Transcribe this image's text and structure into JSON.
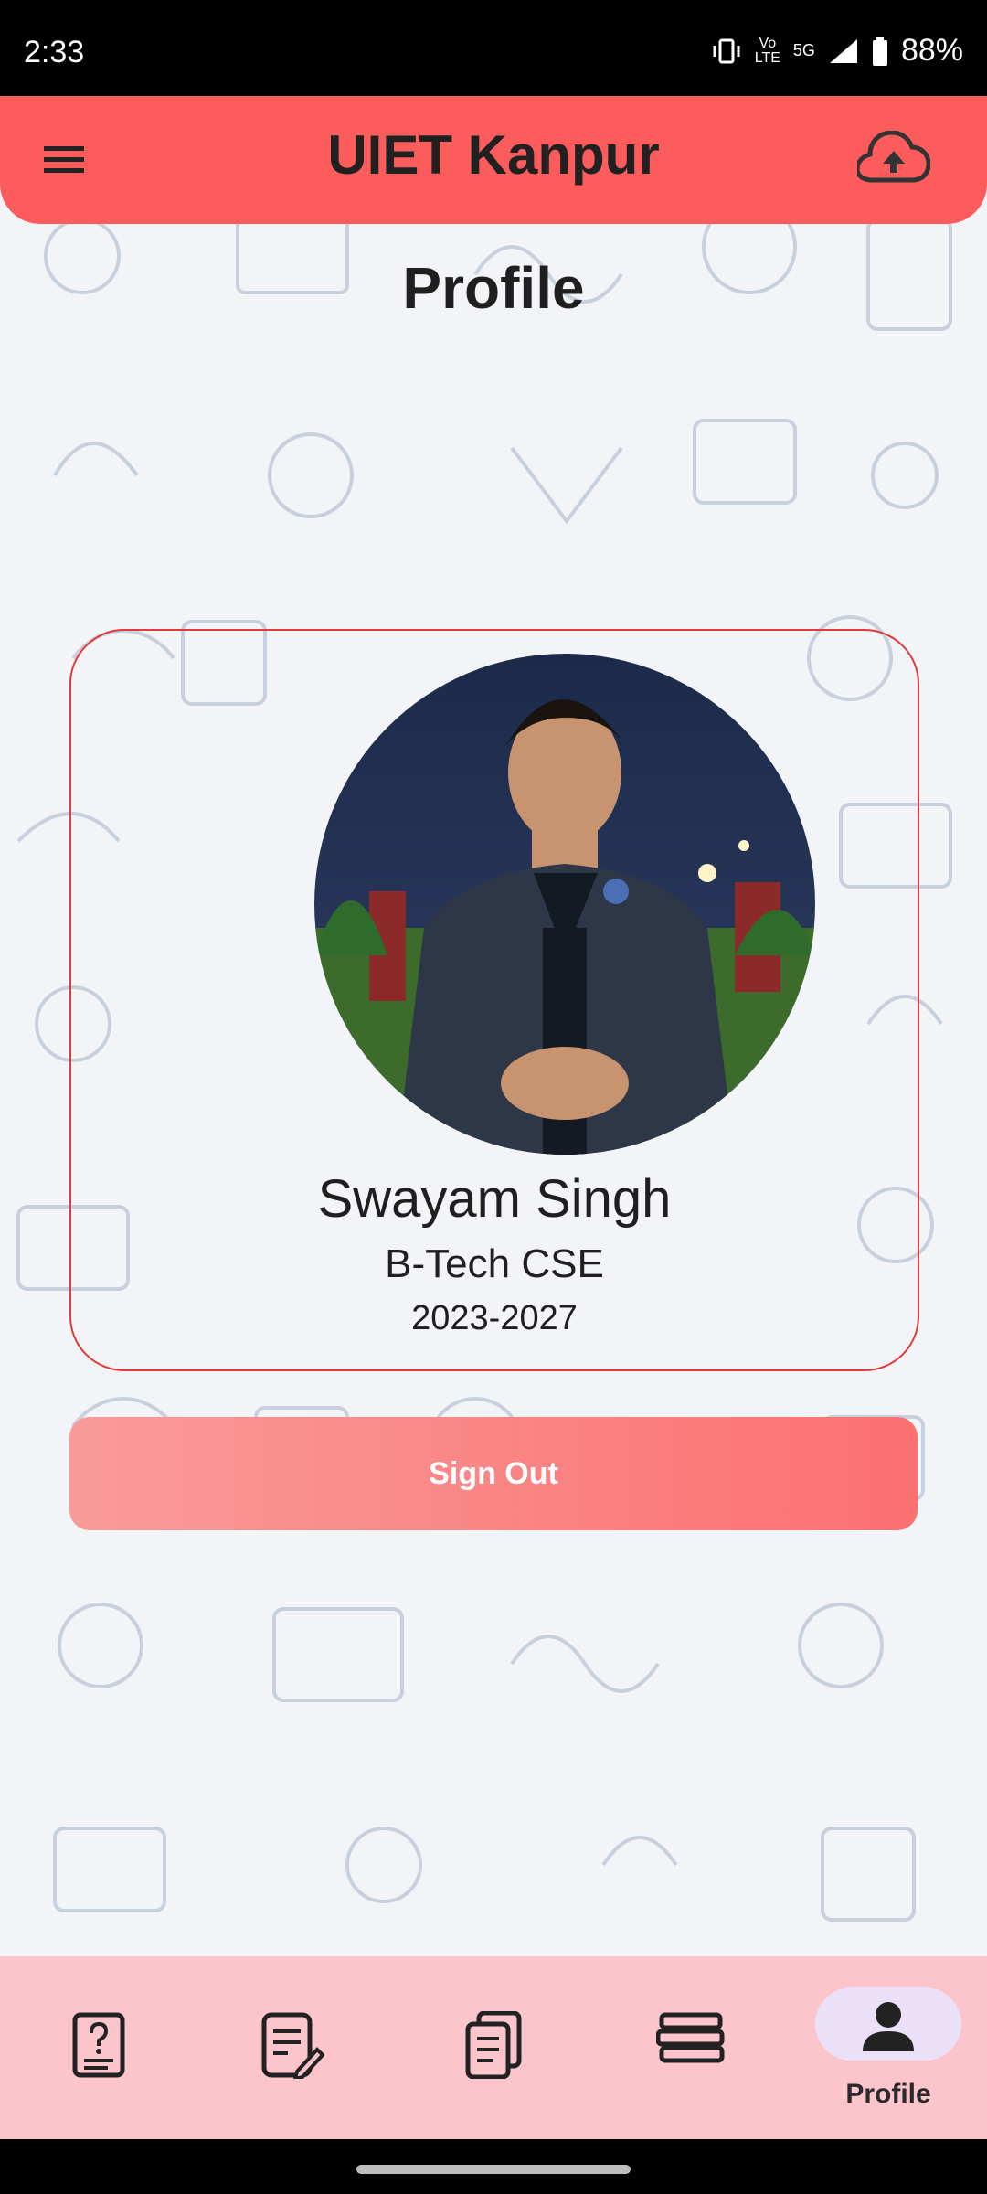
{
  "status_bar": {
    "time": "2:33",
    "network_top": "Vo",
    "network_mid": "LTE",
    "signal": "5G",
    "battery": "88%"
  },
  "app_bar": {
    "title": "UIET Kanpur",
    "menu_icon": "menu-icon",
    "upload_icon": "cloud-upload-icon"
  },
  "page": {
    "title": "Profile"
  },
  "profile": {
    "name": "Swayam Singh",
    "branch": "B-Tech CSE",
    "year": "2023-2027"
  },
  "actions": {
    "sign_out": "Sign Out"
  },
  "bottom_nav": {
    "items": [
      {
        "icon": "question-document-icon",
        "label": ""
      },
      {
        "icon": "edit-document-icon",
        "label": ""
      },
      {
        "icon": "documents-icon",
        "label": ""
      },
      {
        "icon": "books-icon",
        "label": ""
      },
      {
        "icon": "person-icon",
        "label": "Profile"
      }
    ]
  },
  "colors": {
    "accent": "#fd5c5c",
    "nav_bg": "#fcc4cb",
    "selected_pill": "#eae0f7"
  }
}
